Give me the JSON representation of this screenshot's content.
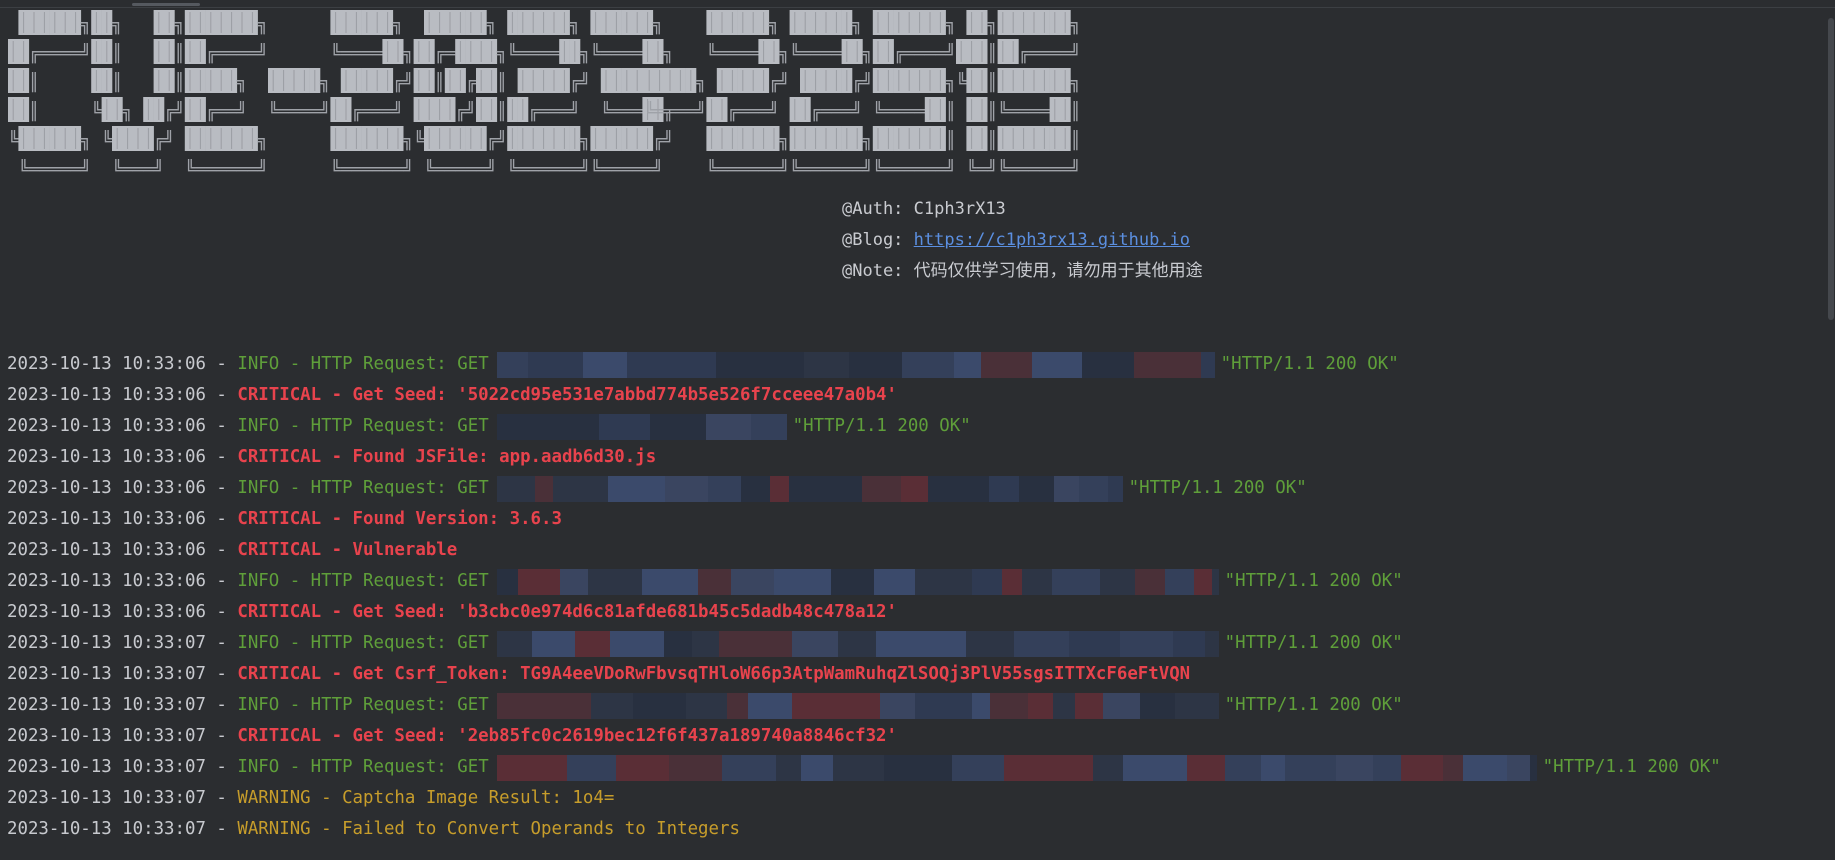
{
  "banner": {
    "left_text": "CVE-2023",
    "right_text": "-22515"
  },
  "meta": {
    "auth_label": "@Auth:",
    "auth_value": "C1ph3rX13",
    "blog_label": "@Blog:",
    "blog_value": "https://c1ph3rx13.github.io",
    "note_label": "@Note:",
    "note_value": "代码仅供学习使用，请勿用于其他用途"
  },
  "colors": {
    "info": "#5f9f3a",
    "critical": "#e8434d",
    "warning": "#c79d2b",
    "link": "#5b8fe0",
    "background": "#2b2d30"
  },
  "log": [
    {
      "ts": "2023-10-13 10:33:06",
      "level": "INFO",
      "msg": "HTTP Request: GET",
      "status": "\"HTTP/1.1 200 OK\"",
      "redacted": true
    },
    {
      "ts": "2023-10-13 10:33:06",
      "level": "CRITICAL",
      "msg": "Get Seed: '5022cd95e531e7abbd774b5e526f7cceee47a0b4'"
    },
    {
      "ts": "2023-10-13 10:33:06",
      "level": "INFO",
      "msg": "HTTP Request: GET",
      "status": "\"HTTP/1.1 200 OK\"",
      "redacted": true
    },
    {
      "ts": "2023-10-13 10:33:06",
      "level": "CRITICAL",
      "msg": "Found JSFile: app.aadb6d30.js"
    },
    {
      "ts": "2023-10-13 10:33:06",
      "level": "INFO",
      "msg": "HTTP Request: GET",
      "status": "\"HTTP/1.1 200 OK\"",
      "redacted": true
    },
    {
      "ts": "2023-10-13 10:33:06",
      "level": "CRITICAL",
      "msg": "Found Version: 3.6.3"
    },
    {
      "ts": "2023-10-13 10:33:06",
      "level": "CRITICAL",
      "msg": "Vulnerable"
    },
    {
      "ts": "2023-10-13 10:33:06",
      "level": "INFO",
      "msg": "HTTP Request: GET",
      "status": "\"HTTP/1.1 200 OK\"",
      "redacted": true
    },
    {
      "ts": "2023-10-13 10:33:06",
      "level": "CRITICAL",
      "msg": "Get Seed: 'b3cbc0e974d6c81afde681b45c5dadb48c478a12'"
    },
    {
      "ts": "2023-10-13 10:33:07",
      "level": "INFO",
      "msg": "HTTP Request: GET",
      "status": "\"HTTP/1.1 200 OK\"",
      "redacted": true
    },
    {
      "ts": "2023-10-13 10:33:07",
      "level": "CRITICAL",
      "msg": "Get Csrf_Token: TG9A4eeVDoRwFbvsqTHloW66p3AtpWamRuhqZlSOQj3PlV55sgsITTXcF6eFtVQN"
    },
    {
      "ts": "2023-10-13 10:33:07",
      "level": "INFO",
      "msg": "HTTP Request: GET",
      "status": "\"HTTP/1.1 200 OK\"",
      "redacted": true
    },
    {
      "ts": "2023-10-13 10:33:07",
      "level": "CRITICAL",
      "msg": "Get Seed: '2eb85fc0c2619bec12f6f437a189740a8846cf32'"
    },
    {
      "ts": "2023-10-13 10:33:07",
      "level": "INFO",
      "msg": "HTTP Request: GET",
      "status": "\"HTTP/1.1 200 OK\"",
      "redacted": true
    },
    {
      "ts": "2023-10-13 10:33:07",
      "level": "WARNING",
      "msg": "Captcha Image Result: 1o4="
    },
    {
      "ts": "2023-10-13 10:33:07",
      "level": "WARNING",
      "msg": "Failed to Convert Operands to Integers"
    }
  ]
}
